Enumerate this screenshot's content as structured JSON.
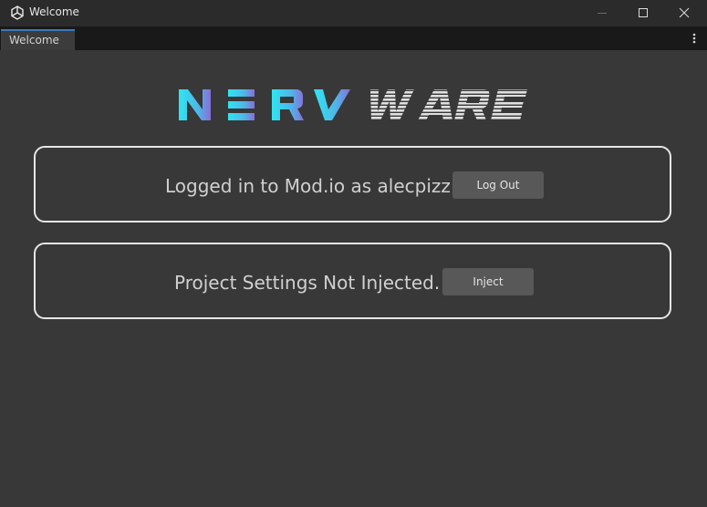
{
  "window": {
    "title": "Welcome",
    "icons": [
      "unity-app-icon",
      "minimize-icon",
      "maximize-icon",
      "close-icon"
    ]
  },
  "tabs": [
    {
      "label": "Welcome",
      "active": true
    }
  ],
  "logo": {
    "text": "NERVWARE",
    "colors": {
      "gradient_start": "#2ee6f0",
      "gradient_end": "#8a6ed8",
      "ware": "#e0e0e0"
    }
  },
  "cards": [
    {
      "status": "Logged in to Mod.io as alecpizz",
      "button_label": "Log Out"
    },
    {
      "status": "Project Settings Not Injected.",
      "button_label": "Inject"
    }
  ],
  "colors": {
    "background": "#383838",
    "titlebar": "#2b2b2b",
    "tabbar": "#191919",
    "button": "#585858",
    "card_border": "#e6e6e6"
  }
}
